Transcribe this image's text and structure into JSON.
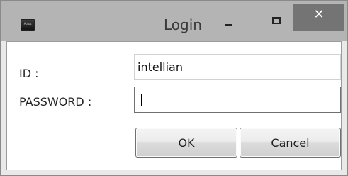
{
  "window": {
    "title": "Login",
    "app_icon_label": "Aptus",
    "minimize_symbol": "–",
    "maximize_symbol": "□",
    "close_symbol": "✕"
  },
  "form": {
    "id_label": "ID :",
    "id_value": "intellian",
    "password_label": "PASSWORD :",
    "password_value": ""
  },
  "buttons": {
    "ok_label": "OK",
    "cancel_label": "Cancel"
  },
  "colors": {
    "titlebar": "#b4b4b4",
    "close_button": "#747474",
    "window_border": "#8a8a8a"
  }
}
